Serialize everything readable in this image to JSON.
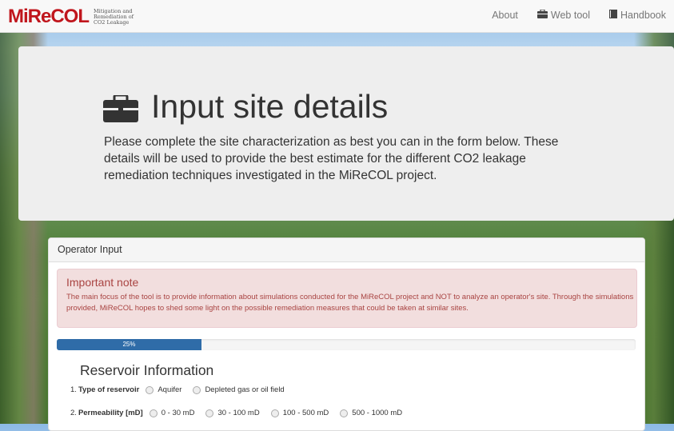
{
  "nav": {
    "logo_text": "MiReCOL",
    "logo_sub": "Mitigation and Remediation of CO2 Leakage",
    "links": [
      {
        "label": "About",
        "icon": ""
      },
      {
        "label": "Web tool",
        "icon": "briefcase-icon"
      },
      {
        "label": "Handbook",
        "icon": "book-icon"
      }
    ]
  },
  "jumbo": {
    "title": "Input site details",
    "text": "Please complete the site characterization as best you can in the form below. These details will be used to provide the best estimate for the different CO2 leakage remediation techniques investigated in the MiReCOL project."
  },
  "panel": {
    "heading": "Operator Input",
    "alert": {
      "title": "Important note",
      "body": "The main focus of the tool is to provide information about simulations conducted for the MiReCOL project and NOT to analyze an operator's site. Through the simulations provided, MiReCOL hopes to shed some light on the possible remediation measures that could be taken at similar sites."
    },
    "progress": {
      "value": 0.25,
      "label": "25%"
    },
    "section_title": "Reservoir Information",
    "questions": [
      {
        "num": "1.",
        "label": "Type of reservoir",
        "options": [
          "Aquifer",
          "Depleted gas or oil field"
        ]
      },
      {
        "num": "2.",
        "label": "Permeability [mD]",
        "options": [
          "0 - 30 mD",
          "30 - 100 mD",
          "100 - 500 mD",
          "500 - 1000 mD"
        ]
      }
    ]
  },
  "colors": {
    "brand": "#c0161d",
    "progress": "#2f6ca8",
    "alert_bg": "#f2dede",
    "alert_text": "#a94442"
  }
}
